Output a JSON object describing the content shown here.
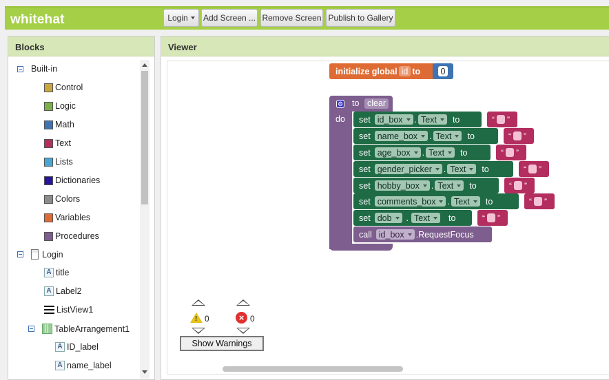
{
  "app": {
    "title": "whitehat"
  },
  "toolbar": {
    "login_label": "Login",
    "add_screen_label": "Add Screen ...",
    "remove_screen_label": "Remove Screen",
    "publish_label": "Publish to Gallery"
  },
  "blocks_panel": {
    "title": "Blocks",
    "builtin": {
      "label": "Built-in",
      "items": [
        {
          "label": "Control",
          "color": "#c9a640"
        },
        {
          "label": "Logic",
          "color": "#7bb04a"
        },
        {
          "label": "Math",
          "color": "#3f73b4"
        },
        {
          "label": "Text",
          "color": "#b32d5e"
        },
        {
          "label": "Lists",
          "color": "#49a6d4"
        },
        {
          "label": "Dictionaries",
          "color": "#27169a"
        },
        {
          "label": "Colors",
          "color": "#8c8c8c"
        },
        {
          "label": "Variables",
          "color": "#df6b34"
        },
        {
          "label": "Procedures",
          "color": "#7d5e8e"
        }
      ]
    },
    "screen": {
      "label": "Login",
      "components": [
        {
          "label": "title",
          "icon": "label-icon"
        },
        {
          "label": "Label2",
          "icon": "label-icon"
        },
        {
          "label": "ListView1",
          "icon": "listview-icon"
        }
      ],
      "arrangement": {
        "label": "TableArrangement1",
        "children": [
          {
            "label": "ID_label",
            "icon": "label-icon"
          },
          {
            "label": "name_label",
            "icon": "label-icon"
          }
        ]
      }
    }
  },
  "viewer": {
    "title": "Viewer",
    "global_var": {
      "prefix": "initialize global",
      "name": "id",
      "to": "to",
      "value": "0"
    },
    "procedure": {
      "to": "to",
      "name": "clear",
      "do": "do",
      "set_word": "set",
      "dot": ".",
      "prop": "Text",
      "to_word": "to",
      "quote_open": "“",
      "quote_close": "”",
      "setters": [
        {
          "component": "id_box"
        },
        {
          "component": "name_box"
        },
        {
          "component": "age_box"
        },
        {
          "component": "gender_picker"
        },
        {
          "component": "hobby_box"
        },
        {
          "component": "comments_box"
        },
        {
          "component": "dob"
        }
      ],
      "call": {
        "word": "call",
        "component": "id_box",
        "method": ".RequestFocus"
      }
    },
    "warnings": {
      "warning_count": "0",
      "error_count": "0",
      "button_label": "Show Warnings"
    }
  },
  "colors": {
    "topbar": "#a5cf47",
    "procedure_purple": "#7d5e8e",
    "setter_green": "#1f6b45",
    "text_red": "#b32d5e",
    "variable_orange": "#df6b34",
    "math_blue": "#3f73b4"
  }
}
